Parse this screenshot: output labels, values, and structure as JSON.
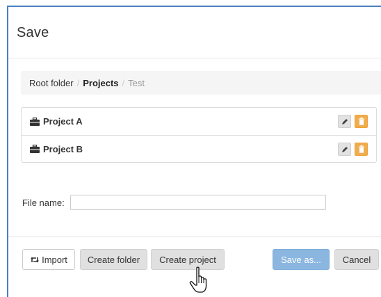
{
  "dialog": {
    "title": "Save"
  },
  "breadcrumb": [
    {
      "label": "Root folder",
      "state": "link"
    },
    {
      "label": "Projects",
      "state": "active"
    },
    {
      "label": "Test",
      "state": "muted"
    }
  ],
  "breadcrumb_separator": "/",
  "projects": [
    {
      "name": "Project A",
      "icon": "briefcase-icon"
    },
    {
      "name": "Project B",
      "icon": "briefcase-icon"
    }
  ],
  "filename": {
    "label": "File name:",
    "value": "",
    "placeholder": ""
  },
  "buttons": {
    "import": "Import",
    "create_folder": "Create folder",
    "create_project": "Create project",
    "save_as": "Save as...",
    "cancel": "Cancel"
  },
  "colors": {
    "accent_border": "#4a7fc1",
    "primary_button": "#8ab6e0",
    "delete_button": "#f0ad4e"
  }
}
